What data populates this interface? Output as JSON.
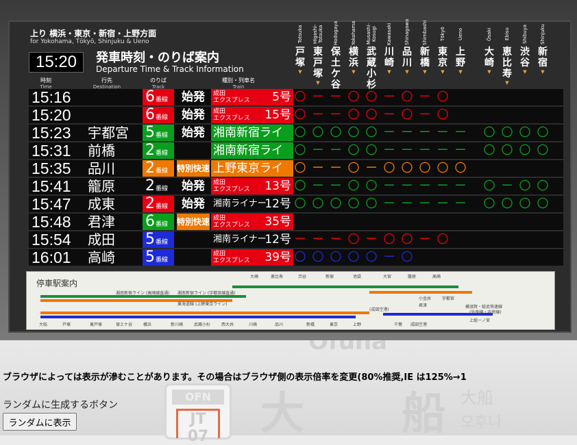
{
  "header": {
    "direction_ja": "上り 横浜・東京・新宿・上野方面",
    "direction_en": "for Yokohama, Tōkyō, Shinjuku & Ueno",
    "clock": "15:20",
    "title_ja": "発車時刻・のりば案内",
    "title_en": "Departure Time & Track Information",
    "col_time_ja": "時刻",
    "col_time_en": "Time",
    "col_dest_ja": "行先",
    "col_dest_en": "Destination",
    "col_track_ja": "のりば",
    "col_track_en": "Track",
    "col_train_ja": "種別・列車名",
    "col_train_en": "Train"
  },
  "stations": [
    {
      "ja": "戸塚",
      "en": "Totsuka"
    },
    {
      "ja": "東戸塚",
      "en": "Higashi-Totsuka"
    },
    {
      "ja": "保土ケ谷",
      "en": "Hodogaya"
    },
    {
      "ja": "横浜",
      "en": "Yokohama"
    },
    {
      "ja": "武蔵小杉",
      "en": "Musashi-Kosugi"
    },
    {
      "ja": "川崎",
      "en": "Kawasaki"
    },
    {
      "ja": "品川",
      "en": "Shinagawa"
    },
    {
      "ja": "新橋",
      "en": "Shimbashi"
    },
    {
      "ja": "東京",
      "en": "Tōkyō"
    },
    {
      "ja": "上野",
      "en": "Ueno"
    },
    {
      "ja": "大崎",
      "en": "Ōsaki"
    },
    {
      "ja": "恵比寿",
      "en": "Ebisu"
    },
    {
      "ja": "渋谷",
      "en": "Shibuya"
    },
    {
      "ja": "新宿",
      "en": "Shinjuku"
    }
  ],
  "departures": [
    {
      "time": "15:16",
      "dest": "",
      "track": "6",
      "track_suffix": "番線",
      "track_color": "#e60012",
      "kind": "始発",
      "kind_color": "",
      "train_line1": "成田",
      "train_line2": "エクスプレス",
      "train_num": "5号",
      "train_color": "#e60012",
      "stops": "〇ーー〇〇ー〇ー〇",
      "stop_color": "#e60012"
    },
    {
      "time": "15:20",
      "dest": "",
      "track": "6",
      "track_suffix": "番線",
      "track_color": "#e60012",
      "kind": "始発",
      "kind_color": "",
      "train_line1": "成田",
      "train_line2": "エクスプレス",
      "train_num": "15号",
      "train_color": "#e60012",
      "stops": "〇ーー〇〇ー〇ー〇",
      "stop_color": "#e60012"
    },
    {
      "time": "15:23",
      "dest": "宇都宮",
      "track": "5",
      "track_suffix": "番線",
      "track_color": "#0a9e1d",
      "kind": "始発",
      "kind_color": "",
      "train_name": "湘南新宿ライン",
      "train_num": "",
      "train_color": "#0a9e1d",
      "stops": "〇〇〇〇〇ーーーーー〇〇〇〇",
      "stop_color": "#0a9e1d"
    },
    {
      "time": "15:31",
      "dest": "前橋",
      "track": "2",
      "track_suffix": "番線",
      "track_color": "#0a9e1d",
      "kind": "",
      "kind_color": "",
      "train_name": "湘南新宿ライン",
      "train_num": "",
      "train_color": "#0a9e1d",
      "stops": "〇ーー〇〇ーーーーー〇〇〇〇",
      "stop_color": "#0a9e1d"
    },
    {
      "time": "15:35",
      "dest": "品川",
      "track": "2",
      "track_suffix": "番線",
      "track_color": "#ee7800",
      "kind": "特別快速",
      "kind_color": "#ee7800",
      "train_name": "上野東京ライン",
      "train_num": "",
      "train_color": "#ee7800",
      "stops": "〇ーー〇ー〇〇〇〇〇",
      "stop_color": "#ee7800"
    },
    {
      "time": "15:41",
      "dest": "籠原",
      "track": "2",
      "track_suffix": "番線",
      "track_color": "",
      "kind": "始発",
      "kind_color": "",
      "train_line1": "成田",
      "train_line2": "エクスプレス",
      "train_num": "13号",
      "train_color": "#e60012",
      "stops": "〇ーー〇〇ーーーーー〇ー〇〇",
      "stop_color": "#0a9e1d"
    },
    {
      "time": "15:47",
      "dest": "成東",
      "track": "2",
      "track_suffix": "番線",
      "track_color": "#e60012",
      "kind": "始発",
      "kind_color": "",
      "train_name": "湘南ライナー",
      "train_num": "12号",
      "train_color": "",
      "stops": "〇〇〇〇〇ーーーーー〇〇〇〇",
      "stop_color": "#0a9e1d"
    },
    {
      "time": "15:48",
      "dest": "君津",
      "track": "6",
      "track_suffix": "番線",
      "track_color": "#0a9e1d",
      "kind": "特別快速",
      "kind_color": "#ee7800",
      "train_line1": "成田",
      "train_line2": "エクスプレス",
      "train_num": "35号",
      "train_color": "#e60012",
      "stops": "",
      "stop_color": ""
    },
    {
      "time": "15:54",
      "dest": "成田",
      "track": "5",
      "track_suffix": "番線",
      "track_color": "#1d2bd6",
      "kind": "",
      "kind_color": "",
      "train_name": "湘南ライナー",
      "train_num": "12号",
      "train_color": "",
      "stops": "ーーー〇ー〇〇ー〇",
      "stop_color": "#e60012"
    },
    {
      "time": "16:01",
      "dest": "高崎",
      "track": "5",
      "track_suffix": "番線",
      "track_color": "#1d2bd6",
      "kind": "",
      "kind_color": "",
      "train_line1": "成田",
      "train_line2": "エクスプレス",
      "train_num": "39号",
      "train_color": "#e60012",
      "stops": "〇〇〇〇〇ー〇",
      "stop_color": "#1d2bd6"
    }
  ],
  "map": {
    "title": "停車駅案内",
    "stations_bottom": [
      "大船",
      "戸塚",
      "東戸塚",
      "保土ケ谷",
      "横浜",
      "新川崎",
      "武蔵小杉",
      "西大井",
      "川崎",
      "品川",
      "新橋",
      "東京",
      "上野",
      "千葉",
      "成田空港"
    ],
    "stations_top": [
      "大崎",
      "恵比寿",
      "渋谷",
      "新宿",
      "池袋",
      "大宮",
      "籠原",
      "高崎"
    ],
    "right_labels": [
      "小金井",
      "宇都宮",
      "君津",
      "横須賀・総武快速線",
      "(外房線・内房線)",
      "上総一ノ宮"
    ],
    "line_labels": [
      "湘南新宿ライン (高崎線直通)",
      "湘南新宿ライン (宇都宮線直通)",
      "東海道線 (上野東京ライン)",
      "(成田空港)"
    ]
  },
  "background": {
    "word_bottom": "Ōfuna",
    "sign_top": "OFN",
    "sign_bot": "JT 07",
    "station_big": "大 船",
    "station_small": "大船",
    "station_korean": "오후나"
  },
  "notice": "ブラウザによっては表示が滲むことがあります。その場合はブラウザ側の表示倍率を変更(80%推奨,IE は125%→1",
  "random": {
    "label": "ランダムに生成するボタン",
    "button": "ランダムに表示"
  },
  "colors": {
    "red": "#e60012",
    "green": "#0a9e1d",
    "orange": "#ee7800",
    "blue": "#1d2bd6",
    "tri": "#e8a33a"
  }
}
